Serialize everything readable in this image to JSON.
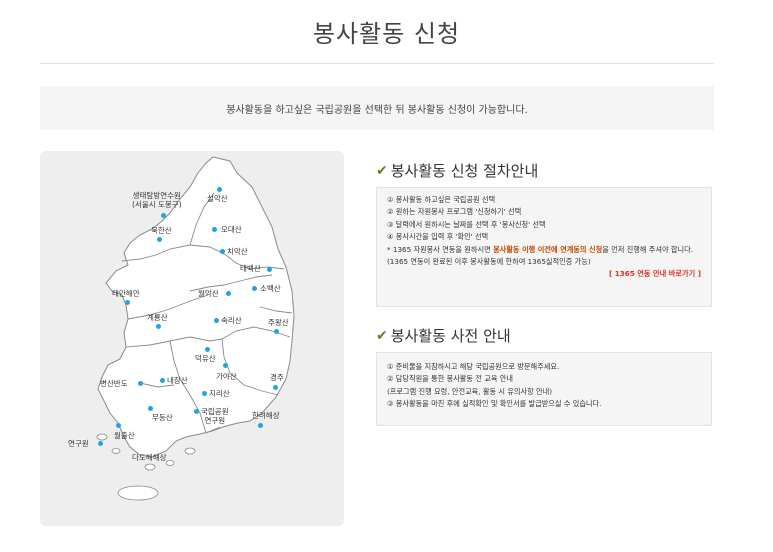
{
  "page": {
    "title": "봉사활동 신청",
    "notice": "봉사활동을 하고싶은 국립공원을 선택한 뒤 봉사활동 신청이 가능합니다."
  },
  "map": {
    "parks": [
      {
        "id": "seonghwan",
        "label": "생태탐방연수원\n(서울시 도봉구)"
      },
      {
        "id": "seorak",
        "label": "설악산"
      },
      {
        "id": "bukhan",
        "label": "북한산"
      },
      {
        "id": "odae",
        "label": "오대산"
      },
      {
        "id": "chiak",
        "label": "치악산"
      },
      {
        "id": "taebaek",
        "label": "태백산"
      },
      {
        "id": "sobaek",
        "label": "소백산"
      },
      {
        "id": "taean",
        "label": "태안해안"
      },
      {
        "id": "woorak",
        "label": "월악산"
      },
      {
        "id": "gyeryong",
        "label": "계룡산"
      },
      {
        "id": "songni",
        "label": "속리산"
      },
      {
        "id": "juwang",
        "label": "주왕산"
      },
      {
        "id": "deogyu",
        "label": "덕유산"
      },
      {
        "id": "byeonsan",
        "label": "변산반도"
      },
      {
        "id": "naejang",
        "label": "내장산"
      },
      {
        "id": "gaya",
        "label": "가야산"
      },
      {
        "id": "gyeongju",
        "label": "경주"
      },
      {
        "id": "jiri",
        "label": "지리산"
      },
      {
        "id": "mudeung",
        "label": "무등산"
      },
      {
        "id": "npark-institute",
        "label": "국립공원\n연구원"
      },
      {
        "id": "hallyeo",
        "label": "한려해상"
      },
      {
        "id": "wolchul",
        "label": "월출산"
      },
      {
        "id": "research",
        "label": "연구원"
      },
      {
        "id": "dadohae",
        "label": "다도해해상"
      }
    ],
    "colors": {
      "land": "#ffffff",
      "border": "#8a8a8a",
      "dot": "#1ea5e6",
      "panel": "#eeeeee"
    }
  },
  "procedure": {
    "title": "봉사활동 신청 절차안내",
    "steps": [
      "① 봉사활동 하고싶은 국립공원 선택",
      "② 원하는 자원봉사 프로그램 '신청하기' 선택",
      "③ 달력에서 원하시는 날짜를 선택 후 '봉사신청' 선택",
      "④ 봉사시간을 입력 후 '확인' 선택"
    ],
    "note_prefix": "* 1365 자원봉사 연동을 원하시면 ",
    "note_highlight": "봉사활동 이행 이전에 연계동의 신청",
    "note_suffix": "을 먼저 진행해 주셔야 합니다. (1365 연동이 완료된 이후 봉사활동에 한하여 1365실적인증 가능)",
    "link": "[ 1365 연동 안내 바로가기 ]"
  },
  "prior": {
    "title": "봉사활동 사전 안내",
    "items": [
      "① 준비물을 지참하시고 해당 국립공원으로 방문해주세요.",
      "② 담당직원을 통한 봉사활동 전 교육 안내",
      "(프로그램 진행 요령, 안전교육, 활동 시 유의사항 안내)",
      "③ 봉사활동을 마친 후에 실적확인 및 확인서를 발급받으실 수 있습니다."
    ]
  }
}
